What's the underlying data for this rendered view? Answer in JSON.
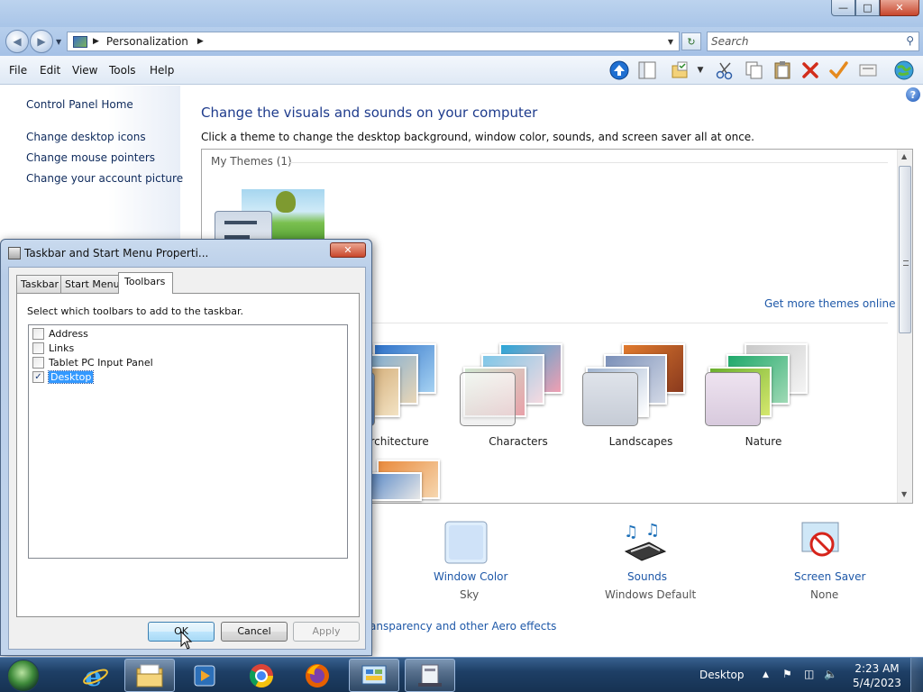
{
  "window": {
    "controls": {
      "minimize": "—",
      "maximize": "□",
      "close": "✕"
    }
  },
  "address": {
    "crumb": "Personalization",
    "search_placeholder": "Search"
  },
  "menubar": [
    "File",
    "Edit",
    "View",
    "Tools",
    "Help"
  ],
  "toolbar_icons": [
    "up-arrow-icon",
    "pane-icon",
    "folder-options-icon",
    "cut-icon",
    "copy-icon",
    "paste-icon",
    "delete-icon",
    "check-icon",
    "properties-icon",
    "globe-icon"
  ],
  "sidebar": {
    "home": "Control Panel Home",
    "links": [
      "Change desktop icons",
      "Change mouse pointers",
      "Change your account picture"
    ]
  },
  "main": {
    "heading": "Change the visuals and sounds on your computer",
    "subtext": "Click a theme to change the desktop background, window color, sounds, and screen saver all at once.",
    "my_themes_label": "My Themes (1)",
    "get_more": "Get more themes online",
    "themes": [
      "Architecture",
      "Characters",
      "Landscapes",
      "Nature"
    ],
    "bottom": [
      {
        "label": "Window Color",
        "value": "Sky"
      },
      {
        "label": "Sounds",
        "value": "Windows Default"
      },
      {
        "label": "Screen Saver",
        "value": "None"
      }
    ],
    "aero_link": "ansparency and other Aero effects"
  },
  "dialog": {
    "title": "Taskbar and Start Menu Properti...",
    "close": "✕",
    "tabs": [
      "Taskbar",
      "Start Menu",
      "Toolbars"
    ],
    "active_tab": "Toolbars",
    "instruction": "Select which toolbars to add to the taskbar.",
    "toolbars": [
      {
        "label": "Address",
        "checked": false
      },
      {
        "label": "Links",
        "checked": false
      },
      {
        "label": "Tablet PC Input Panel",
        "checked": false
      },
      {
        "label": "Desktop",
        "checked": true
      }
    ],
    "buttons": {
      "ok": "OK",
      "cancel": "Cancel",
      "apply": "Apply"
    }
  },
  "taskbar": {
    "apps": [
      "internet-explorer-icon",
      "file-explorer-icon",
      "media-player-icon",
      "chrome-icon",
      "firefox-icon",
      "control-panel-icon",
      "taskbar-properties-icon"
    ],
    "tray_toolbar": "Desktop",
    "time": "2:23 AM",
    "date": "5/4/2023"
  },
  "colors": {
    "link": "#1e58a8",
    "heading": "#1e3b8c",
    "selection": "#3399ff"
  }
}
